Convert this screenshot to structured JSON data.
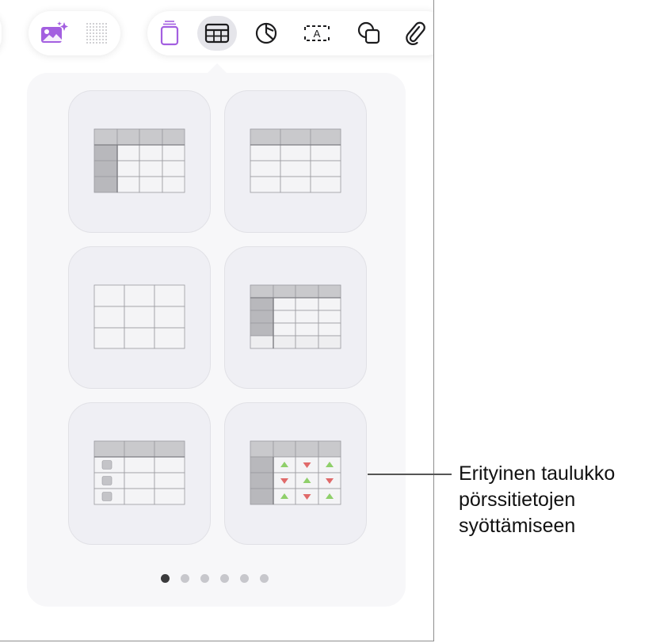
{
  "toolbar": {
    "left_tools": [
      {
        "name": "media",
        "icon": "photo-sparkle-icon"
      },
      {
        "name": "grid",
        "icon": "dot-grid-icon"
      }
    ],
    "main_tools": [
      {
        "name": "text-box",
        "icon": "text-box-icon"
      },
      {
        "name": "table",
        "icon": "table-icon",
        "active": true
      },
      {
        "name": "chart",
        "icon": "chart-icon"
      },
      {
        "name": "text",
        "icon": "text-frame-icon",
        "glyph": "A"
      },
      {
        "name": "shape",
        "icon": "shapes-icon"
      },
      {
        "name": "attachment",
        "icon": "paperclip-icon"
      }
    ],
    "accent_color": "#a35fe0"
  },
  "table_styles": [
    {
      "style": "header-row-and-column"
    },
    {
      "style": "header-row"
    },
    {
      "style": "plain"
    },
    {
      "style": "header-row-column-footer"
    },
    {
      "style": "checklist"
    },
    {
      "style": "stock"
    }
  ],
  "pagination": {
    "pages": 6,
    "current": 1
  },
  "callout": {
    "lines": [
      "Erityinen taulukko",
      "pörssitietojen",
      "syöttämiseen"
    ]
  },
  "colors": {
    "header_fill": "#c9c9cc",
    "cell_fill": "#f4f4f6",
    "grid_line": "#9a9a9f",
    "up_arrow": "#8fcf6a",
    "down_arrow": "#e06a6a"
  }
}
